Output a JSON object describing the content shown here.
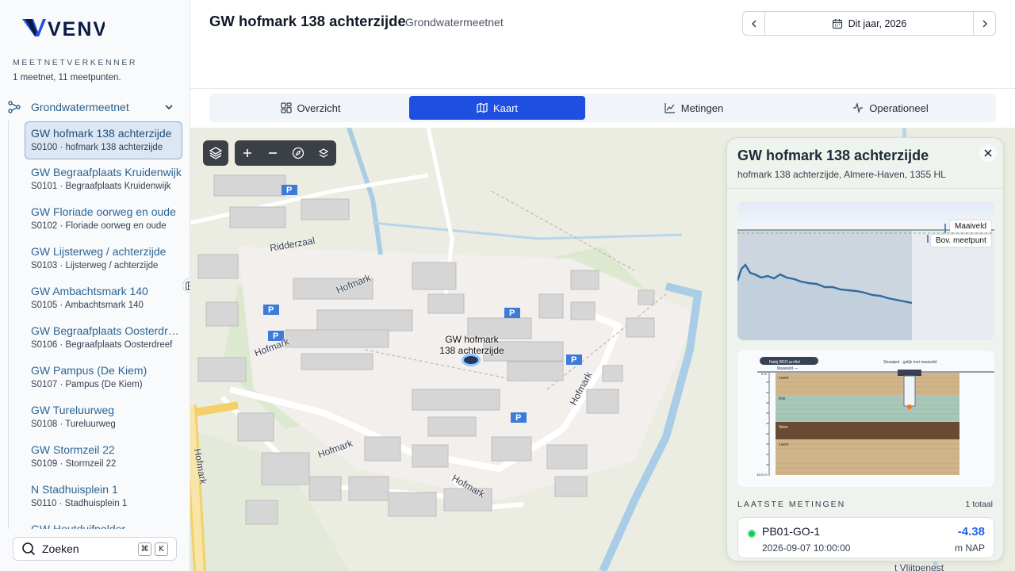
{
  "brand": {
    "logo_text": "VENV"
  },
  "sidebar": {
    "section_title": "MEETNETVERKENNER",
    "section_subtitle": "1 meetnet, 11 meetpunten.",
    "network": {
      "label": "Grondwatermeetnet",
      "icon": "network-icon",
      "expanded": true
    },
    "items": [
      {
        "title": "GW hofmark 138 achterzijde",
        "sub": "S0100 · hofmark 138 achterzijde",
        "active": true
      },
      {
        "title": "GW Begraafplaats Kruidenwijk",
        "sub": "S0101 · Begraafplaats Kruidenwijk"
      },
      {
        "title": "GW Floriade oorweg en oude",
        "sub": "S0102 · Floriade oorweg en oude"
      },
      {
        "title": "GW Lijsterweg / achterzijde",
        "sub": "S0103 · Lijsterweg / achterzijde"
      },
      {
        "title": "GW Ambachtsmark 140",
        "sub": "S0105 · Ambachtsmark 140"
      },
      {
        "title": "GW Begraafplaats Oosterdreef",
        "sub": "S0106 · Begraafplaats Oosterdreef"
      },
      {
        "title": "GW Pampus (De Kiem)",
        "sub": "S0107 · Pampus (De Kiem)"
      },
      {
        "title": "GW Tureluurweg",
        "sub": "S0108 · Tureluurweg"
      },
      {
        "title": "GW Stormzeil 22",
        "sub": "S0109 · Stormzeil 22"
      },
      {
        "title": "N Stadhuisplein 1",
        "sub": "S0110 · Stadhuisplein 1"
      },
      {
        "title": "GW Houtduifpolder",
        "sub": ""
      }
    ],
    "search": {
      "label": "Zoeken",
      "key1": "⌘",
      "key2": "K"
    }
  },
  "header": {
    "title": "GW hofmark 138 achterzijde",
    "subtitle": "Grondwatermeetnet",
    "date_label": "Dit jaar, 2026"
  },
  "tabs": [
    {
      "label": "Overzicht",
      "icon": "grid-icon"
    },
    {
      "label": "Kaart",
      "icon": "map-icon",
      "active": true
    },
    {
      "label": "Metingen",
      "icon": "line-chart-icon"
    },
    {
      "label": "Operationeel",
      "icon": "activity-icon"
    }
  ],
  "map": {
    "marker_label": "GW hofmark\n138 achterzijde",
    "streets": [
      "Hofmark",
      "Hofmark",
      "Hofmark",
      "Hofmark",
      "Hofmark",
      "Ridderzaal",
      "Hofmark",
      "t Vlijtpenest"
    ],
    "park_label": "P"
  },
  "card": {
    "title": "GW hofmark 138 achterzijde",
    "address": "hofmark 138 achterzijde, Almere-Haven, 1355 HL",
    "chart_tags": {
      "ground": "Maaiveld",
      "top": "Bov. meetpunt"
    },
    "profile": {
      "badge": "Nabij BRO-profiel",
      "caption": "Straatpot · gelijk met maaiveld",
      "ground_label": "Maaiveld —",
      "depth_top": "0 m",
      "depth_bottom": "10.5 m",
      "layers": [
        "Leem",
        "Klei",
        "Veen",
        "Leem"
      ]
    },
    "latest_title": "LAATSTE METINGEN",
    "latest_count": "1 totaal",
    "measurement": {
      "code": "PB01-GO-1",
      "time": "2026-09-07 10:00:00",
      "value": "-4.38",
      "unit": "m NAP"
    }
  },
  "colors": {
    "accent": "#1f4fe0",
    "link": "#2f6594",
    "status_ok": "#22c55e",
    "value": "#2563eb"
  }
}
